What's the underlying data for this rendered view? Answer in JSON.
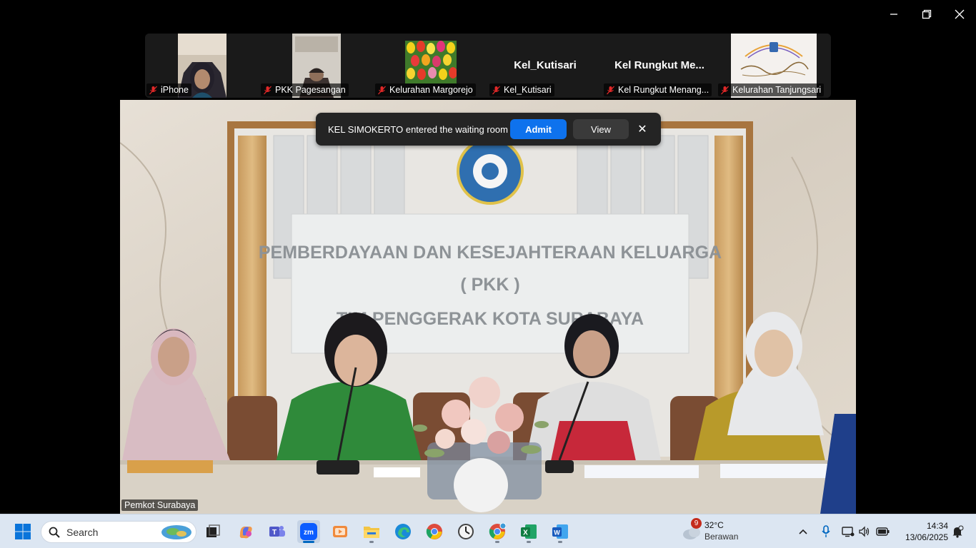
{
  "window": {
    "minimize_label": "—",
    "restore_label": "❐",
    "close_label": "✕"
  },
  "gallery": [
    {
      "name": "iPhone",
      "type": "video"
    },
    {
      "name": "PKK Pagesangan",
      "type": "video"
    },
    {
      "name": "Kelurahan Margorejo",
      "type": "image"
    },
    {
      "name": "Kel_Kutisari",
      "display": "Kel_Kutisari",
      "type": "name"
    },
    {
      "name": "Kel Rungkut Menang...",
      "display": "Kel  Rungkut  Me...",
      "type": "name"
    },
    {
      "name": "Kelurahan Tanjungsari",
      "type": "logo"
    }
  ],
  "main_video": {
    "speaker": "Pemkot Surabaya",
    "wall_text": [
      "PEMBERDAYAAN DAN KESEJAHTERAAN KELUARGA",
      "( PKK )",
      "TIM PENGGERAK KOTA SURABAYA"
    ]
  },
  "toast": {
    "message": "KEL SIMOKERTO entered the waiting room",
    "admit_label": "Admit",
    "view_label": "View",
    "close_label": "✕"
  },
  "taskbar": {
    "search_placeholder": "Search",
    "apps": [
      "start-menu",
      "task-view",
      "copilot",
      "teams",
      "zoom",
      "media-player",
      "file-explorer",
      "edge",
      "chrome",
      "clock-app",
      "chrome-profile",
      "excel",
      "word"
    ],
    "active_app": "zoom",
    "weather": {
      "temperature": "32°C",
      "condition": "Berawan",
      "badge": "9"
    },
    "clock": {
      "time": "14:34",
      "date": "13/06/2025"
    }
  },
  "colors": {
    "accent": "#0e72ed",
    "taskbar": "#dce6f2",
    "strip": "#1a1a1a",
    "mic_off": "#e02828"
  }
}
